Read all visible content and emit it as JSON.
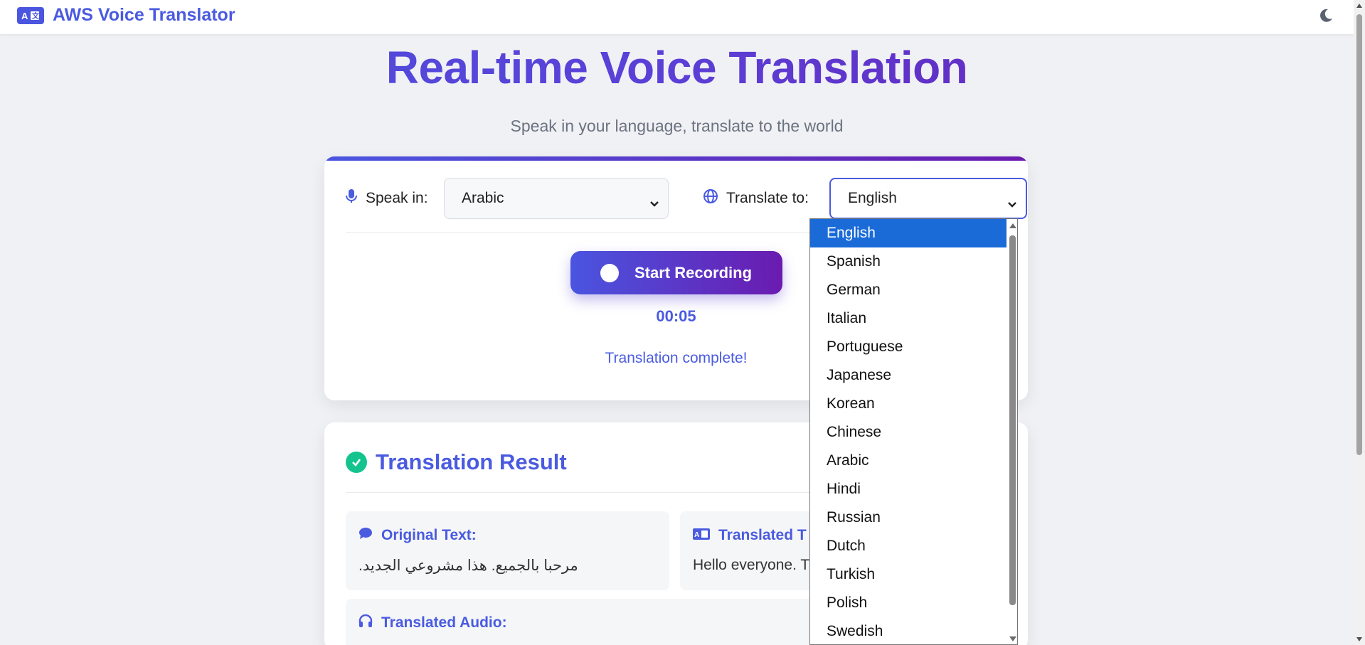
{
  "header": {
    "brand_icon": "translate-icon",
    "title": "AWS Voice Translator",
    "theme_icon": "moon-icon"
  },
  "hero": {
    "title": "Real-time Voice Translation",
    "subtitle": "Speak in your language, translate to the world"
  },
  "controls": {
    "speak_in_label": "Speak in:",
    "speak_in_value": "Arabic",
    "translate_to_label": "Translate to:",
    "translate_to_value": "English",
    "record_button": "Start Recording",
    "timer": "00:05",
    "status": "Translation complete!"
  },
  "result": {
    "title": "Translation Result",
    "original_label": "Original Text:",
    "original_text": "مرحبا بالجميع. هذا مشروعي الجديد.",
    "translated_label": "Translated T",
    "translated_text": "Hello everyone. T",
    "audio_label": "Translated Audio:"
  },
  "dropdown": {
    "options": [
      "English",
      "Spanish",
      "German",
      "Italian",
      "Portuguese",
      "Japanese",
      "Korean",
      "Chinese",
      "Arabic",
      "Hindi",
      "Russian",
      "Dutch",
      "Turkish",
      "Polish",
      "Swedish"
    ],
    "selected": "English"
  },
  "colors": {
    "accent": "#4a5be0",
    "gradient_end": "#6a1bb0",
    "success": "#14c38e",
    "selected_option": "#1a6bd8"
  }
}
